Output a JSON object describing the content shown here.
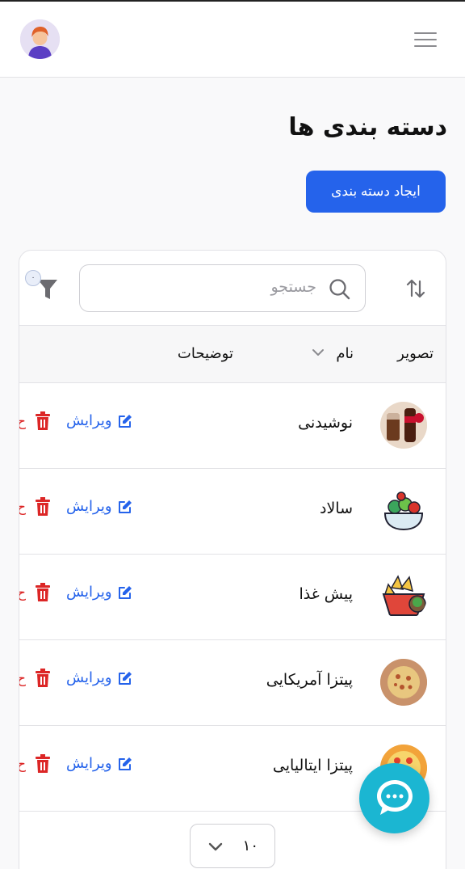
{
  "header": {
    "avatar": "user-avatar",
    "menu_icon": "hamburger-icon"
  },
  "page": {
    "title": "دسته بندی ها",
    "create_button": "ایجاد دسته بندی"
  },
  "toolbar": {
    "search_placeholder": "جستجو",
    "filter_count": "۰"
  },
  "table": {
    "columns": {
      "image": "تصویر",
      "name": "نام",
      "description": "توضیحات"
    },
    "rows": [
      {
        "name": "نوشیدنی",
        "image": "drinks-image",
        "edit": "ویرایش",
        "delete": "ح"
      },
      {
        "name": "سالاد",
        "image": "salad-image",
        "edit": "ویرایش",
        "delete": "ح"
      },
      {
        "name": "پیش غذا",
        "image": "appetizer-image",
        "edit": "ویرایش",
        "delete": "ح"
      },
      {
        "name": "پیتزا آمریکایی",
        "image": "american-pizza-image",
        "edit": "ویرایش",
        "delete": "ح"
      },
      {
        "name": "پیتزا ایتالیایی",
        "image": "italian-pizza-image",
        "edit": "ویرایش",
        "delete": "ح"
      }
    ]
  },
  "pagination": {
    "page_size": "۱۰"
  },
  "colors": {
    "primary": "#2563eb",
    "danger": "#dc2626",
    "chat": "#1bb6d2"
  }
}
